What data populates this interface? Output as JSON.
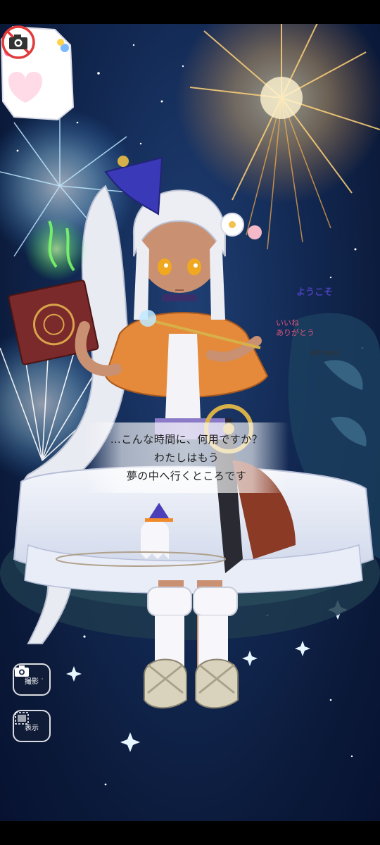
{
  "dialogue": {
    "line1": "…こんな時間に、何用ですか？",
    "line2": "わたしはもう",
    "line3": "夢の中へ行くところです"
  },
  "welcome_board": {
    "title": "ようこそ",
    "thanks_line1": "いいね",
    "thanks_line2": "ありがとう",
    "subtitle": "撮影大歓迎♪",
    "icon": "camera-icon"
  },
  "controls": {
    "photo_label": "撮影",
    "display_label": "表示",
    "photo_icon": "camera-icon",
    "display_icon": "frame-icon"
  },
  "colors": {
    "sky": "#132a55",
    "firework_gold": "#ffb24a",
    "firework_blue": "#8fd6ff",
    "cape": "#e58a3a",
    "accent_purple": "#4a3fb8"
  }
}
